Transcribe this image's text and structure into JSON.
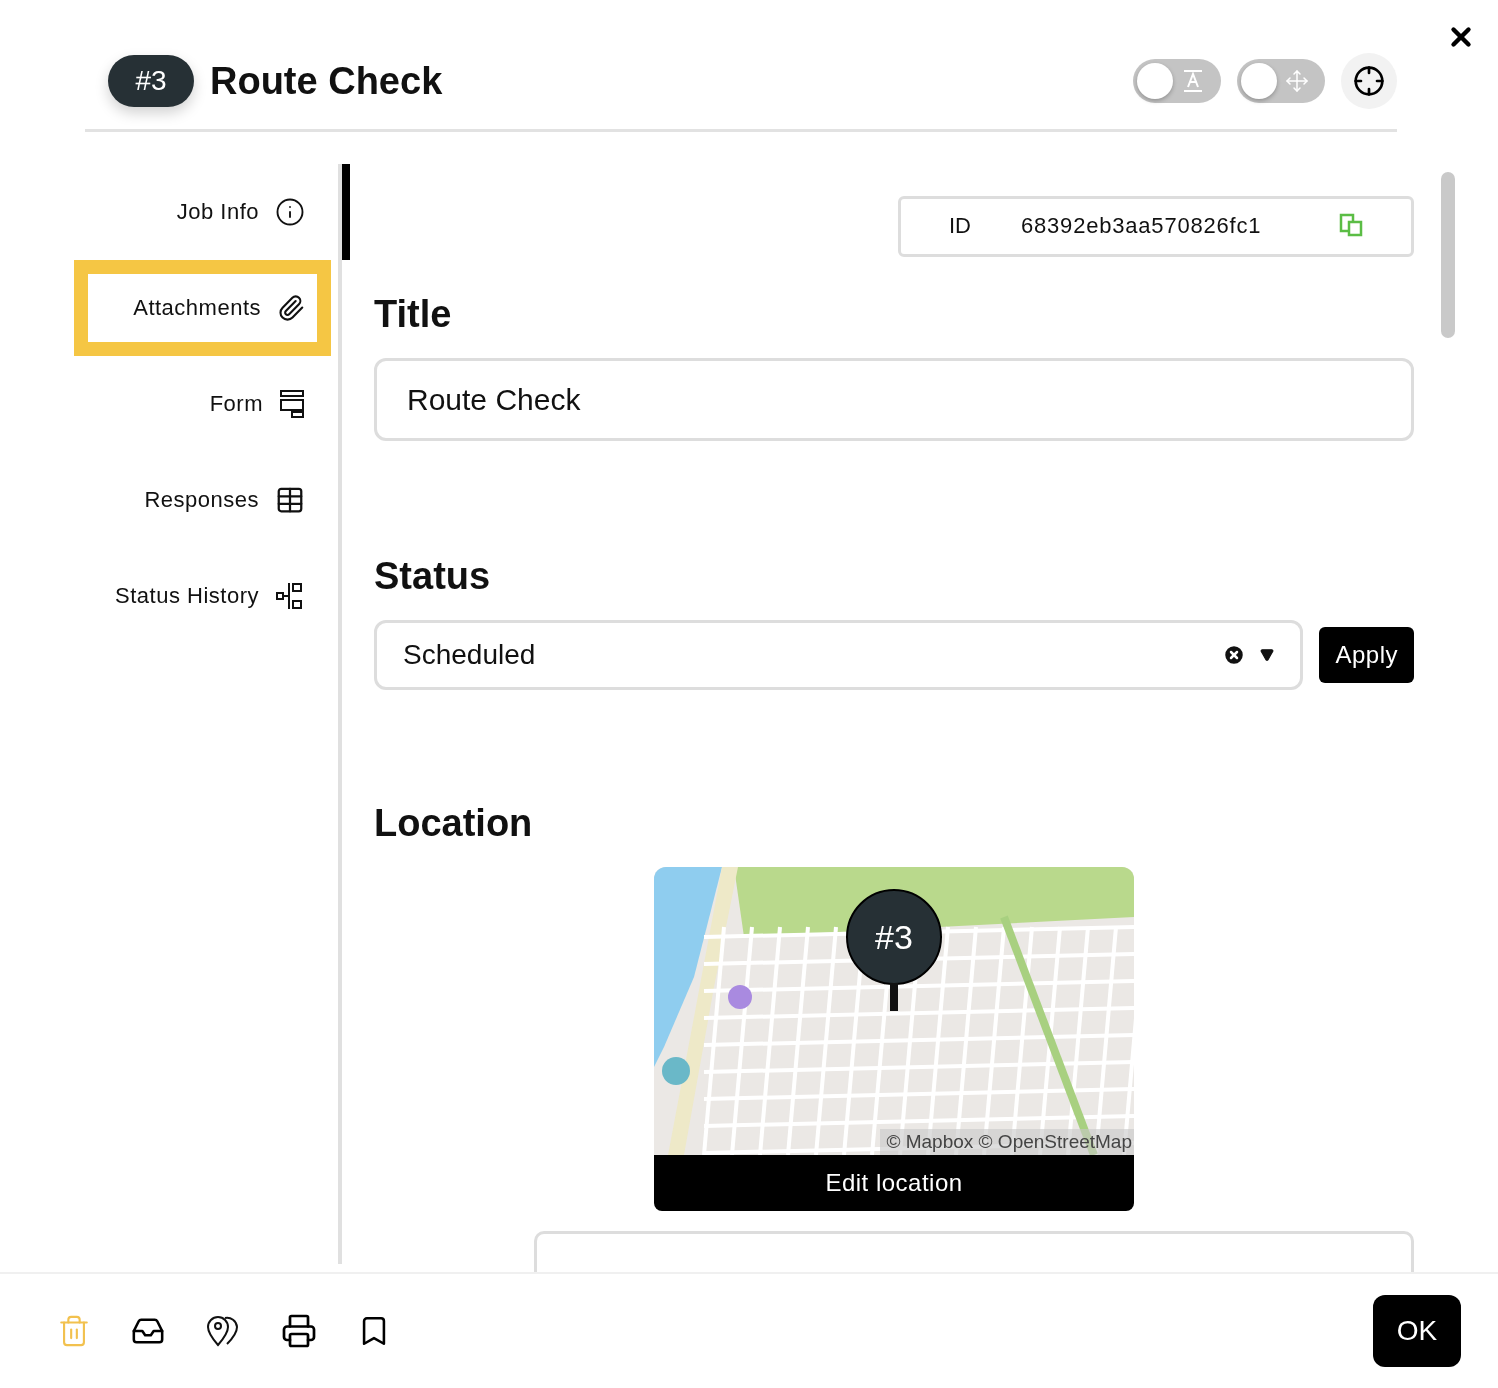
{
  "header": {
    "badge": "#3",
    "title": "Route Check",
    "toggles": [
      {
        "kind": "text",
        "on": false
      },
      {
        "kind": "move",
        "on": false
      }
    ]
  },
  "sidebar": {
    "items": [
      {
        "label": "Job Info",
        "selected": true,
        "focused": false
      },
      {
        "label": "Attachments",
        "selected": false,
        "focused": true
      },
      {
        "label": "Form",
        "selected": false,
        "focused": false
      },
      {
        "label": "Responses",
        "selected": false,
        "focused": false
      },
      {
        "label": "Status History",
        "selected": false,
        "focused": false
      }
    ]
  },
  "id_field": {
    "label": "ID",
    "value": "68392eb3aa570826fc1"
  },
  "sections": {
    "title": {
      "heading": "Title",
      "value": "Route Check"
    },
    "status": {
      "heading": "Status",
      "value": "Scheduled",
      "button": "Apply"
    },
    "location": {
      "heading": "Location",
      "marker": "#3",
      "attribution": "© Mapbox © OpenStreetMap",
      "button": "Edit location"
    }
  },
  "footer": {
    "ok": "OK"
  }
}
